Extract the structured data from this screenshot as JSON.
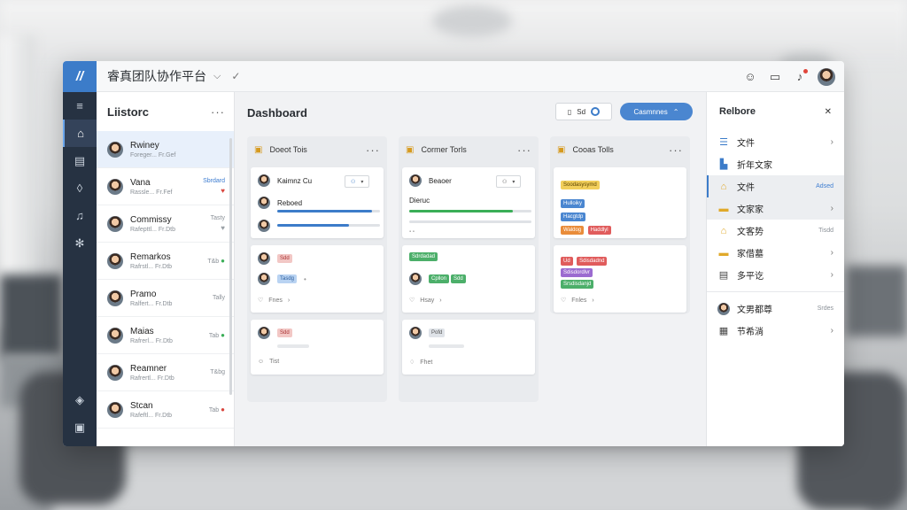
{
  "app": {
    "title": "睿真团队协作平台"
  },
  "list_panel": {
    "title": "Liistorc",
    "items": [
      {
        "name": "Rwiney",
        "sub": "Foreger... Fr.Gef",
        "meta": ""
      },
      {
        "name": "Vana",
        "sub": "Rassle... Fr.Fef",
        "meta": "Sbrdard"
      },
      {
        "name": "Commissy",
        "sub": "Rafepttl... Fr.Dtb",
        "meta": "Tasty"
      },
      {
        "name": "Remarkos",
        "sub": "Rafrstl... Fr.Dtb",
        "meta": "T&b"
      },
      {
        "name": "Pramo",
        "sub": "Ralfert... Fr.Dtb",
        "meta": "Tally"
      },
      {
        "name": "Maias",
        "sub": "Rafrerl... Fr.Dtb",
        "meta": "Tab"
      },
      {
        "name": "Reamner",
        "sub": "Rafrertl... Fr.Dtb",
        "meta": "T&bg"
      },
      {
        "name": "Stcan",
        "sub": "Rafeftl... Fr.Dtb",
        "meta": "Tab"
      }
    ]
  },
  "dashboard": {
    "title": "Dashboard",
    "ctrl_label": "Sd",
    "button_label": "Casmnnes",
    "columns": [
      {
        "title": "Doeot Tois",
        "card1_name": "Kaimnz Cu",
        "card1_sub": "Reboed",
        "card2_tag": "Sdd",
        "card2_tag2": "Tasdg",
        "card2_foot": "Fnes",
        "card3_tag": "Sdd",
        "card3_foot": "Tist"
      },
      {
        "title": "Cormer Torls",
        "card1_name": "Beaoer",
        "card1_sub": "Dieruc",
        "card2_tag": "Sdrdadad",
        "card2_tag2": "Cpllon",
        "card2_tag3": "Sdd",
        "card2_foot": "Hsay",
        "card3_tag": "Pofd",
        "card3_foot": "Fhet"
      },
      {
        "title": "Cooas Tolls",
        "tags1": [
          "Soodasysymd",
          "Hulloiky",
          "Hacgtdp",
          "Waldog",
          "Haddlyl"
        ],
        "tags2": [
          "Ud",
          "Sdisdadnd",
          "Sdisdordlvr",
          "Srsdisdanjd"
        ],
        "card2_foot": "Fnles"
      }
    ]
  },
  "right_panel": {
    "title": "Relbore",
    "items": [
      {
        "icon": "list-icon",
        "label": "文件",
        "right": ""
      },
      {
        "icon": "doc-icon",
        "label": "折年文家",
        "right": ""
      },
      {
        "icon": "home-icon",
        "label": "文件",
        "right": "Adsed"
      },
      {
        "icon": "folder-icon",
        "label": "文家家",
        "right": ""
      },
      {
        "icon": "home-icon",
        "label": "文客势",
        "right": "Tisdd"
      },
      {
        "icon": "folder-icon",
        "label": "家借墓",
        "right": ""
      },
      {
        "icon": "sheet-icon",
        "label": "多平讫",
        "right": ""
      },
      {
        "icon": "avatar",
        "label": "文男都尊",
        "right": "Srdes"
      },
      {
        "icon": "table-icon",
        "label": "节希淌",
        "right": ""
      }
    ]
  },
  "colors": {
    "accent": "#3c7cc9",
    "rail": "#263242",
    "progress_blue": "#3c7cc9",
    "progress_green": "#3aae57"
  }
}
